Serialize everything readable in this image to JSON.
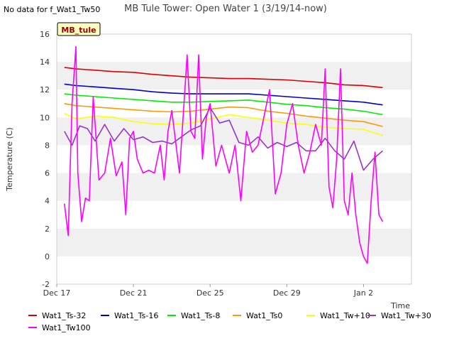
{
  "no_data_note": "No data for f_Wat1_Tw50",
  "site_badge": "MB_tule",
  "colors": {
    "Wat1_Ts-32": "#dd0000",
    "Wat1_Ts-16": "#0000cc",
    "Wat1_Ts-8": "#00ee00",
    "Wat1_Ts0": "#ff9900",
    "Wat1_Tw+10": "#ffff00",
    "Wat1_Tw+30": "#9933cc",
    "Wat1_Tw100": "#ff00ff",
    "band": "#f0f0f0",
    "badge_fill": "#ffffc0",
    "badge_text": "#990000"
  },
  "chart_data": {
    "type": "line",
    "title": "MB Tule Tower: Open Water 1 (3/19/14-now)",
    "xlabel": "Time",
    "ylabel": "Temperature (C)",
    "ylim": [
      -2,
      16
    ],
    "xlim": [
      "Dec 17",
      "Jan 3 12:00"
    ],
    "x_unit": "days since Dec 17",
    "xticks": [
      {
        "label": "Dec 17",
        "x": 0
      },
      {
        "label": "Dec 21",
        "x": 4
      },
      {
        "label": "Dec 25",
        "x": 8
      },
      {
        "label": "Dec 29",
        "x": 12
      },
      {
        "label": "Jan 2",
        "x": 16
      }
    ],
    "yticks": [
      -2,
      0,
      2,
      4,
      6,
      8,
      10,
      12,
      14,
      16
    ],
    "legend_position": "bottom",
    "grid": "alternating horizontal bands",
    "series": [
      {
        "name": "Wat1_Ts-32",
        "x": [
          0.4,
          1,
          2,
          3,
          4,
          5,
          6,
          7,
          8,
          9,
          10,
          11,
          12,
          13,
          14,
          15,
          16,
          17
        ],
        "y": [
          13.6,
          13.5,
          13.4,
          13.3,
          13.25,
          13.1,
          13.0,
          12.9,
          12.85,
          12.8,
          12.8,
          12.75,
          12.7,
          12.6,
          12.5,
          12.35,
          12.3,
          12.15
        ]
      },
      {
        "name": "Wat1_Ts-16",
        "x": [
          0.4,
          1,
          2,
          3,
          4,
          5,
          6,
          7,
          8,
          9,
          10,
          11,
          12,
          13,
          14,
          15,
          16,
          17
        ],
        "y": [
          12.4,
          12.3,
          12.2,
          12.1,
          12.0,
          11.85,
          11.75,
          11.7,
          11.7,
          11.7,
          11.7,
          11.6,
          11.5,
          11.4,
          11.3,
          11.2,
          11.1,
          10.9
        ]
      },
      {
        "name": "Wat1_Ts-8",
        "x": [
          0.4,
          1,
          2,
          3,
          4,
          5,
          6,
          7,
          8,
          9,
          10,
          11,
          12,
          13,
          14,
          15,
          16,
          17
        ],
        "y": [
          11.7,
          11.6,
          11.5,
          11.4,
          11.3,
          11.2,
          11.1,
          11.1,
          11.15,
          11.2,
          11.25,
          11.1,
          10.95,
          10.85,
          10.7,
          10.6,
          10.45,
          10.2
        ]
      },
      {
        "name": "Wat1_Ts0",
        "x": [
          0.4,
          1,
          2,
          3,
          4,
          5,
          6,
          7,
          8,
          9,
          10,
          11,
          12,
          13,
          14,
          15,
          16,
          17
        ],
        "y": [
          11.0,
          10.85,
          10.75,
          10.65,
          10.55,
          10.45,
          10.4,
          10.45,
          10.6,
          10.75,
          10.7,
          10.45,
          10.3,
          10.1,
          9.95,
          9.8,
          9.7,
          9.35
        ]
      },
      {
        "name": "Wat1_Tw+10",
        "x": [
          0.4,
          1,
          2,
          3,
          4,
          5,
          6,
          7,
          8,
          9,
          10,
          11,
          12,
          13,
          14,
          15,
          16,
          17
        ],
        "y": [
          10.3,
          9.9,
          10.1,
          10.0,
          9.7,
          9.55,
          9.5,
          9.6,
          9.9,
          10.2,
          10.0,
          9.8,
          9.6,
          9.5,
          9.3,
          9.2,
          9.15,
          8.7
        ]
      },
      {
        "name": "Wat1_Tw+30",
        "x": [
          0.4,
          0.8,
          1.2,
          1.6,
          2.0,
          2.5,
          3.0,
          3.5,
          4.0,
          4.5,
          5.0,
          5.5,
          6.0,
          6.5,
          7.0,
          7.5,
          8.0,
          8.5,
          9.0,
          9.5,
          10.0,
          10.5,
          11.0,
          11.5,
          12.0,
          12.5,
          13.0,
          13.5,
          14.0,
          14.5,
          15.0,
          15.5,
          16.0,
          16.5,
          17.0
        ],
        "y": [
          9.0,
          8.0,
          9.4,
          9.2,
          8.3,
          9.5,
          8.3,
          9.2,
          8.4,
          8.6,
          8.2,
          8.3,
          8.1,
          8.6,
          9.1,
          9.4,
          10.7,
          9.6,
          9.8,
          8.2,
          8.0,
          8.6,
          7.8,
          8.2,
          7.9,
          8.2,
          7.6,
          7.6,
          8.5,
          7.6,
          7.0,
          8.3,
          6.2,
          7.0,
          7.6
        ]
      },
      {
        "name": "Wat1_Tw100",
        "x": [
          0.4,
          0.6,
          0.8,
          1.0,
          1.1,
          1.3,
          1.5,
          1.7,
          1.9,
          2.2,
          2.5,
          2.8,
          3.1,
          3.4,
          3.6,
          3.8,
          4.0,
          4.2,
          4.5,
          4.8,
          5.1,
          5.4,
          5.6,
          5.8,
          6.0,
          6.4,
          6.8,
          7.0,
          7.2,
          7.4,
          7.6,
          7.8,
          8.0,
          8.3,
          8.6,
          9.0,
          9.3,
          9.6,
          9.9,
          10.2,
          10.5,
          10.8,
          11.1,
          11.4,
          11.7,
          12.0,
          12.3,
          12.6,
          12.9,
          13.2,
          13.5,
          13.8,
          14.0,
          14.2,
          14.4,
          14.6,
          14.8,
          15.0,
          15.2,
          15.4,
          15.6,
          15.8,
          16.0,
          16.2,
          16.4,
          16.6,
          16.8,
          17.0
        ],
        "y": [
          3.8,
          1.5,
          11.0,
          15.1,
          6.0,
          2.5,
          4.2,
          4.0,
          11.5,
          5.5,
          6.0,
          8.5,
          5.8,
          6.8,
          3.0,
          8.5,
          9.0,
          7.0,
          6.0,
          6.2,
          6.0,
          8.0,
          5.5,
          9.0,
          10.5,
          6.0,
          14.5,
          9.0,
          8.5,
          14.5,
          7.0,
          10.0,
          11.0,
          6.5,
          8.0,
          6.0,
          8.0,
          4.0,
          9.0,
          7.5,
          8.0,
          10.0,
          12.0,
          4.5,
          6.0,
          9.5,
          11.0,
          8.0,
          6.0,
          7.5,
          9.5,
          8.0,
          13.5,
          5.0,
          3.5,
          7.0,
          13.5,
          4.0,
          3.0,
          6.0,
          3.0,
          1.0,
          0.0,
          -0.5,
          4.0,
          7.5,
          3.0,
          2.5
        ]
      }
    ]
  }
}
